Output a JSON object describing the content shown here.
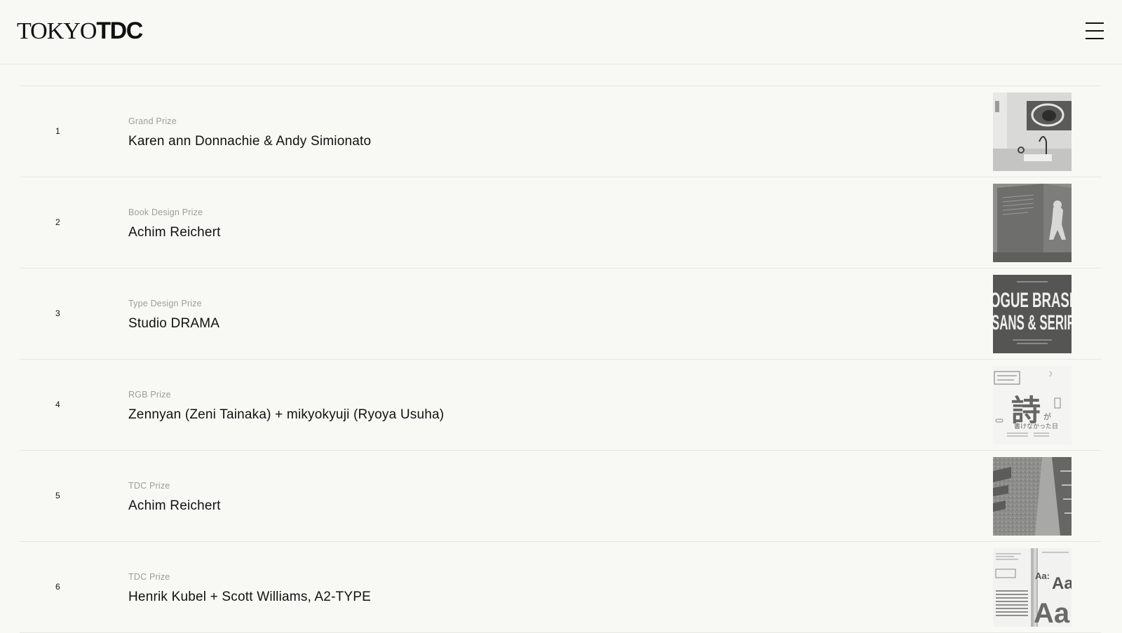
{
  "header": {
    "logo_light": "TOKYO",
    "logo_bold": "TDC",
    "menu_icon": "hamburger-menu-icon"
  },
  "winners": [
    {
      "rank": "1",
      "category": "Grand Prize",
      "name": "Karen ann Donnachie & Andy Simionato",
      "thumb_icon": "gallery-installation-image"
    },
    {
      "rank": "2",
      "category": "Book Design Prize",
      "name": "Achim Reichert",
      "thumb_icon": "book-cover-image"
    },
    {
      "rank": "3",
      "category": "Type Design Prize",
      "name": "Studio DRAMA",
      "thumb_icon": "type-specimen-image",
      "thumb_text_line1": "OGUE BRASI",
      "thumb_text_line2": "SANS & SERIF"
    },
    {
      "rank": "4",
      "category": "RGB Prize",
      "name": "Zennyan (Zeni Tainaka) + mikyokyuji (Ryoya Usuha)",
      "thumb_icon": "poem-poster-image",
      "thumb_text_kanji": "詩",
      "thumb_text_ga": "が",
      "thumb_text_line": "書けなかった日"
    },
    {
      "rank": "5",
      "category": "TDC Prize",
      "name": "Achim Reichert",
      "thumb_icon": "textured-book-image"
    },
    {
      "rank": "6",
      "category": "TDC Prize",
      "name": "Henrik Kubel + Scott Williams, A2-TYPE",
      "thumb_icon": "type-book-spread-image",
      "thumb_text_a1": "Aa:",
      "thumb_text_a2": "Aa",
      "thumb_text_a3": "Aa"
    }
  ]
}
